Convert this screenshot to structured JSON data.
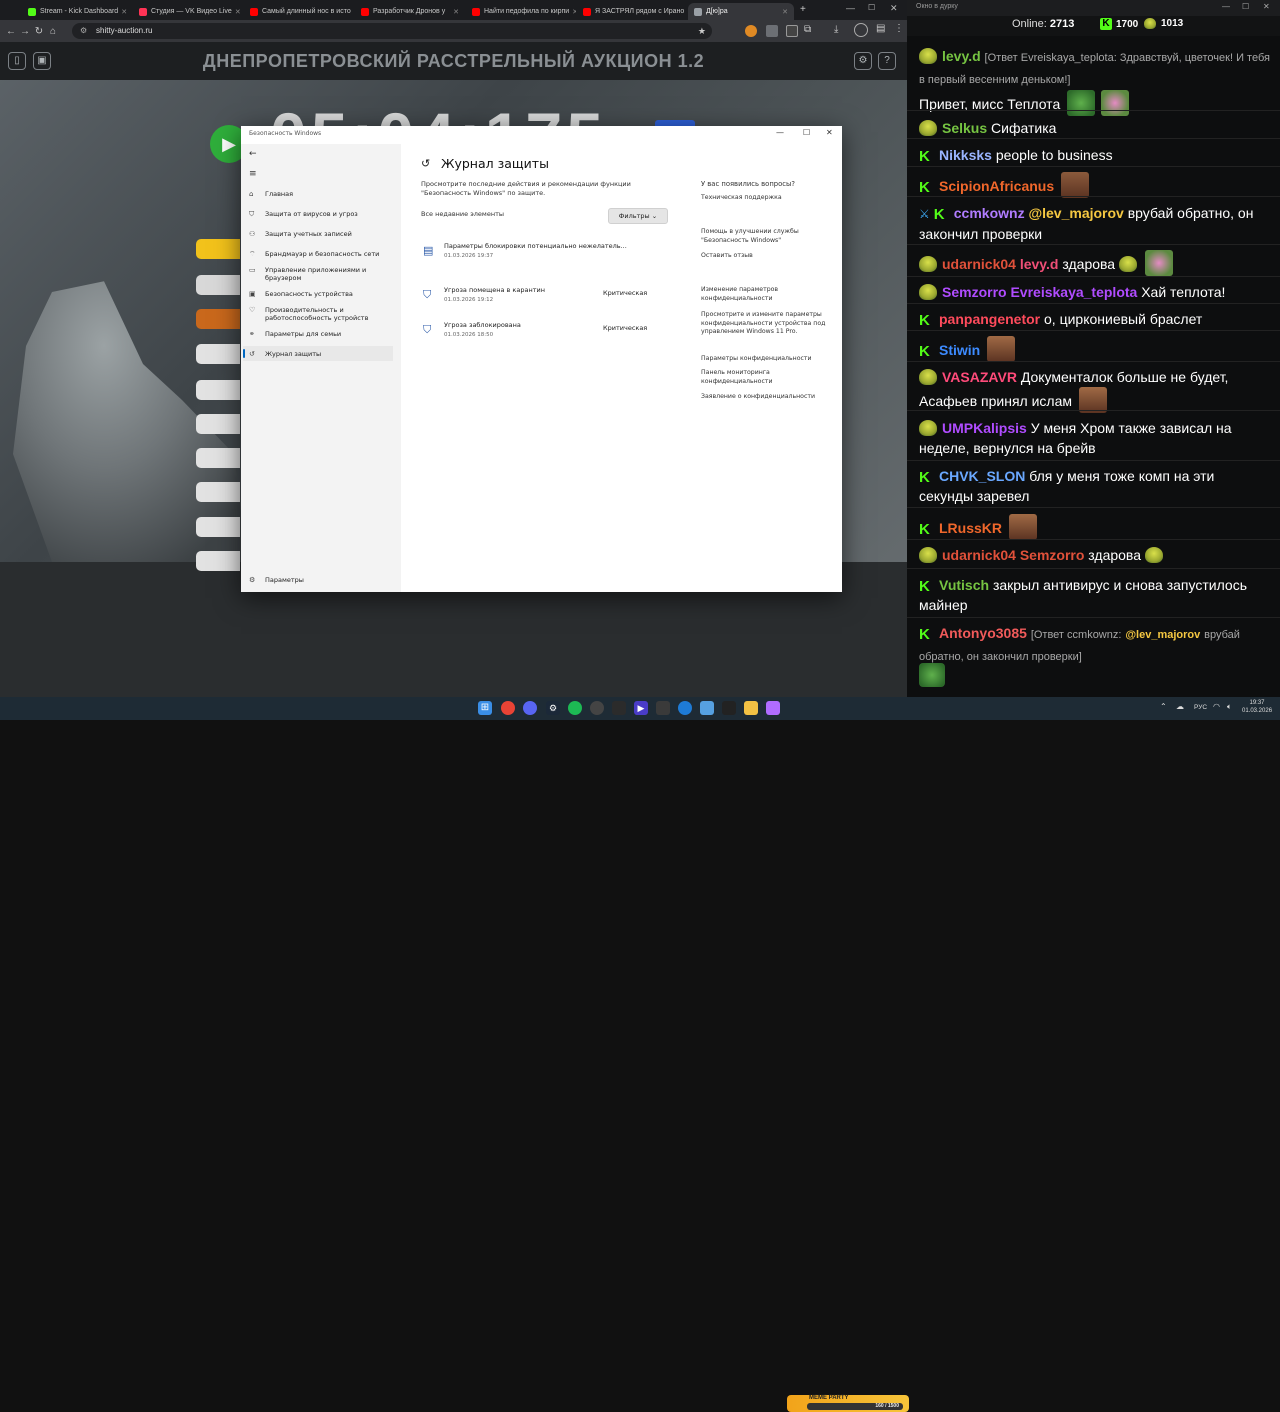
{
  "browser": {
    "tabs": [
      {
        "label": "Stream - Kick Dashboard",
        "icon": "kick-icon",
        "color": "#53fc18"
      },
      {
        "label": "Студия — VK Видео Live",
        "icon": "vk-icon",
        "color": "#ff3355"
      },
      {
        "label": "Самый длинный нос в исто",
        "icon": "youtube-icon",
        "color": "#ff0000"
      },
      {
        "label": "Разработчик Дронов у",
        "icon": "youtube-icon",
        "color": "#ff0000"
      },
      {
        "label": "Найти педофила по кирпи",
        "icon": "youtube-icon",
        "color": "#ff0000"
      },
      {
        "label": "Я ЗАСТРЯЛ рядом с Ирано",
        "icon": "youtube-icon",
        "color": "#ff0000"
      },
      {
        "label": "Д[ю]ра",
        "icon": "page-icon",
        "color": "#9aa0a6"
      }
    ],
    "url": "shitty-auction.ru"
  },
  "page": {
    "title": "ДНЕПРОПЕТРОВСКИЙ РАССТРЕЛЬНЫЙ АУКЦИОН 1.2",
    "timer": "05:04:175"
  },
  "security": {
    "window_title": "Безопасность Windows",
    "nav": [
      {
        "label": "Главная",
        "icon": "home-icon"
      },
      {
        "label": "Защита от вирусов и угроз",
        "icon": "shield-icon"
      },
      {
        "label": "Защита учетных записей",
        "icon": "person-icon"
      },
      {
        "label": "Брандмауэр и безопасность сети",
        "icon": "wifi-icon"
      },
      {
        "label": "Управление приложениями и браузером",
        "icon": "app-icon"
      },
      {
        "label": "Безопасность устройства",
        "icon": "device-icon"
      },
      {
        "label": "Производительность и работоспособность устройств",
        "icon": "heart-icon"
      },
      {
        "label": "Параметры для семьи",
        "icon": "family-icon"
      },
      {
        "label": "Журнал защиты",
        "icon": "history-icon"
      }
    ],
    "settings_label": "Параметры",
    "heading": "Журнал защиты",
    "description": "Просмотрите последние действия и рекомендации функции \"Безопасность Windows\" по защите.",
    "all_items": "Все недавние элементы",
    "filters": "Фильтры",
    "entries": [
      {
        "title": "Параметры блокировки потенциально нежелатель...",
        "date": "01.03.2026 19:37",
        "severity": ""
      },
      {
        "title": "Угроза помещена в карантин",
        "date": "01.03.2026 19:12",
        "severity": "Критическая"
      },
      {
        "title": "Угроза заблокирована",
        "date": "01.03.2026 18:50",
        "severity": "Критическая"
      }
    ],
    "right": {
      "q_heading": "У вас появились вопросы?",
      "q_link": "Техническая поддержка",
      "help_heading": "Помощь в улучшении службы \"Безопасность Windows\"",
      "help_link": "Оставить отзыв",
      "priv_heading": "Изменение параметров конфиденциальности",
      "priv_text": "Просмотрите и измените параметры конфиденциальности устройства под управлением Windows 11 Pro.",
      "priv_link1": "Параметры конфиденциальности",
      "priv_link2": "Панель мониторинга конфиденциальности",
      "priv_link3": "Заявление о конфиденциальности"
    }
  },
  "chat": {
    "window_title": "Окно в дурку",
    "online_label": "Online:",
    "online_count": "2713",
    "followers": "1700",
    "subs": "1013",
    "messages": [
      {
        "user": "levy.d",
        "color": "#76c442",
        "reply": "[Ответ Evreiskaya_teplota: Здравствуй, цветочек! И тебя в первый весенним деньком!]",
        "text": "Привет, мисс Теплота"
      },
      {
        "user": "Selkus",
        "color": "#76c442",
        "text": "Сифатика"
      },
      {
        "user": "Nikksks",
        "color": "#9ab5ff",
        "text": "people to business"
      },
      {
        "user": "ScipionAfricanus",
        "color": "#f0672b",
        "text": ""
      },
      {
        "user": "ccmkownz",
        "color": "#b07cff",
        "mention": "@lev_majorov",
        "text": "врубай обратно, он закончил проверки"
      },
      {
        "user": "udarnick04",
        "color": "#e0513a",
        "mention2": "levy.d",
        "text": "здарова"
      },
      {
        "user": "Semzorro",
        "color": "#b04cff",
        "mention2": "Evreiskaya_teplota",
        "text": "Хай теплота!"
      },
      {
        "user": "panpangenetor",
        "color": "#ff4b5c",
        "text": "о, циркониевый браслет"
      },
      {
        "user": "Stiwin",
        "color": "#3d8bff",
        "text": ""
      },
      {
        "user": "VASAZAVR",
        "color": "#ff4b7a",
        "text": "Документалок больше не будет, Асафьев принял ислам"
      },
      {
        "user": "UMPKalipsis",
        "color": "#b04cff",
        "text": "У меня Хром также зависал на неделе, вернулся на брейв"
      },
      {
        "user": "CHVK_SLON",
        "color": "#6aa8ff",
        "text": "бля у меня тоже комп на эти секунды заревел"
      },
      {
        "user": "LRussKR",
        "color": "#f0672b",
        "text": ""
      },
      {
        "user": "udarnick04",
        "color": "#e0513a",
        "mention2": "Semzorro",
        "text": "здарова"
      },
      {
        "user": "Vutisch",
        "color": "#76c442",
        "text": "закрыл антивирус и снова запустилось майнер"
      },
      {
        "user": "Antonyo3085",
        "color": "#f05a5a",
        "reply": "[Ответ ccmkownz:",
        "mention": "@lev_majorov",
        "reply_tail": "врубай обратно, он закончил проверки]"
      }
    ]
  },
  "taskbar": {
    "lang": "РУС",
    "time": "19:37",
    "date": "01.03.2026",
    "widget_text": "МЕМЕ PARTY",
    "widget_counter": "160 / 1500"
  }
}
